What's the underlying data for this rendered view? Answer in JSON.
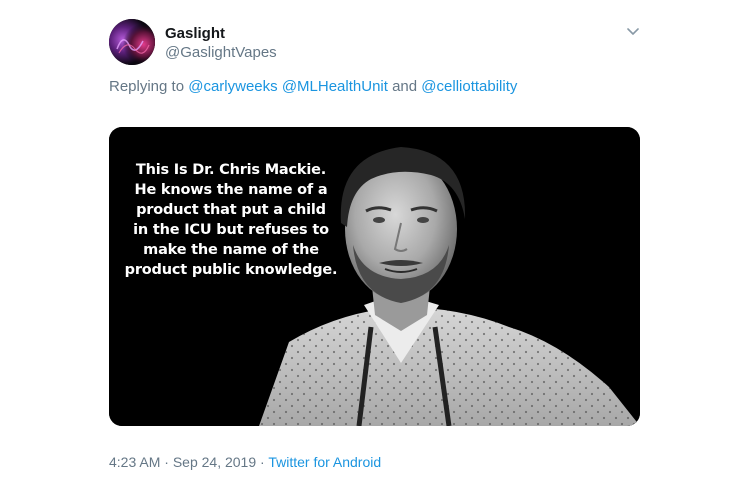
{
  "tweet": {
    "author": {
      "display_name": "Gaslight",
      "handle": "@GaslightVapes"
    },
    "reply": {
      "prefix": "Replying to",
      "mentions": [
        "@carlyweeks",
        "@MLHealthUnit",
        "@celliottability"
      ],
      "conjunction": "and"
    },
    "image": {
      "caption_lines": [
        "This Is Dr. Chris Mackie.",
        "He knows the name of a",
        "product that put a child",
        "in the ICU but refuses to",
        "make the name of the",
        "product public knowledge."
      ]
    },
    "meta": {
      "time": "4:23 AM",
      "separator": "·",
      "date": "Sep 24, 2019",
      "source": "Twitter for Android"
    },
    "icons": {
      "more_menu": "chevron-down-icon"
    },
    "colors": {
      "link": "#1b95e0",
      "secondary_text": "#657786",
      "primary_text": "#14171a"
    }
  }
}
